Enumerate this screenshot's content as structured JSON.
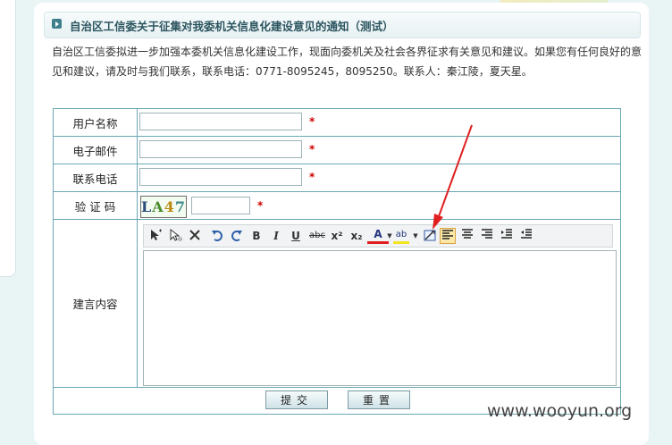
{
  "notice": {
    "title": "自治区工信委关于征集对我委机关信息化建设意见的通知（测试）",
    "intro": "自治区工信委拟进一步加强本委机关信息化建设工作，现面向委机关及社会各界征求有关意见和建议。如果您有任何良好的意见和建议，请及时与我们联系，联系电话：0771-8095245，8095250。联系人：秦江陵，夏天星。"
  },
  "form": {
    "username_label": "用户名称",
    "email_label": "电子邮件",
    "phone_label": "联系电话",
    "captcha_label": "验 证 码",
    "content_label": "建言内容",
    "required_mark": "*",
    "captcha_text": [
      "L",
      "A",
      "4",
      "7"
    ],
    "submit_label": "提交",
    "reset_label": "重置"
  },
  "toolbar": {
    "buttons": [
      "select-icon",
      "pointer-icon",
      "delete-icon",
      "undo-icon",
      "redo-icon",
      "bold-icon",
      "italic-icon",
      "underline-icon",
      "strikethrough-icon",
      "superscript-icon",
      "subscript-icon",
      "font-color-icon",
      "highlight-icon",
      "edit-image-icon",
      "align-left-icon",
      "align-center-icon",
      "align-right-icon",
      "indent-icon",
      "outdent-icon"
    ],
    "glyphs": {
      "bold": "B",
      "italic": "I",
      "underline": "U",
      "strike": "abc",
      "sup": "x²",
      "sub": "x₂",
      "fontcolor": "A",
      "highlight": "ab"
    }
  },
  "colors": {
    "accent": "#3f7f8c",
    "required": "#cc0000",
    "annotation": "#e02020"
  },
  "watermark": "www.wooyun.org"
}
